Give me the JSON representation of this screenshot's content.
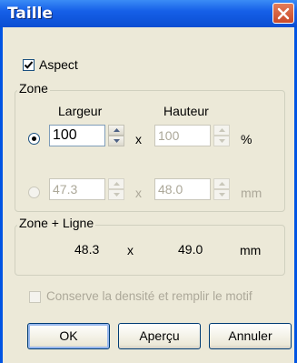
{
  "window": {
    "title": "Taille",
    "close_icon": "close-icon"
  },
  "aspect": {
    "label": "Aspect",
    "checked": true
  },
  "zone": {
    "title": "Zone",
    "col_width": "Largeur",
    "col_height": "Hauteur",
    "row_percent": {
      "selected": true,
      "width_value": "100",
      "height_value": "100",
      "separator": "x",
      "unit": "%"
    },
    "row_mm": {
      "selected": false,
      "width_value": "47.3",
      "height_value": "48.0",
      "separator": "x",
      "unit": "mm"
    }
  },
  "zone_ligne": {
    "title": "Zone + Ligne",
    "width": "48.3",
    "separator": "x",
    "height": "49.0",
    "unit": "mm"
  },
  "conserve": {
    "label": "Conserve la densité et remplir le motif",
    "checked": false
  },
  "buttons": {
    "ok": "OK",
    "preview": "Aperçu",
    "cancel": "Annuler"
  },
  "colors": {
    "titlebar": "#0a4ed2",
    "dialog_bg": "#ece9d8",
    "close": "#c94a2a"
  }
}
